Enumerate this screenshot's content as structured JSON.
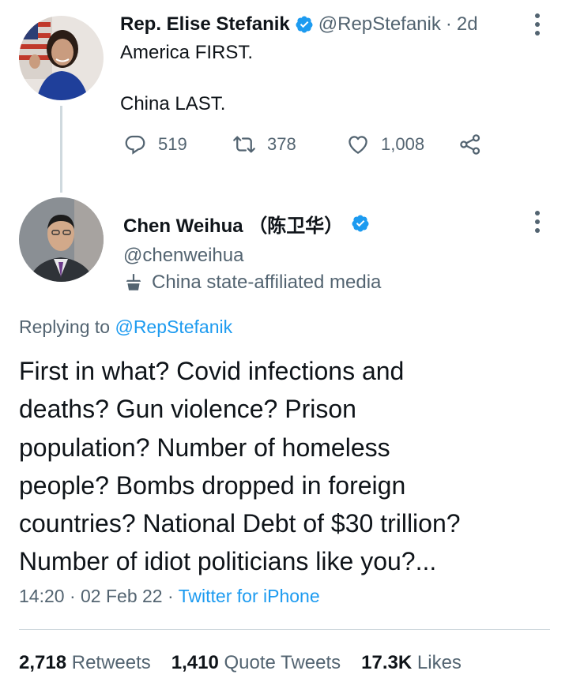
{
  "parent_tweet": {
    "author_name": "Rep. Elise Stefanik",
    "handle": "@RepStefanik",
    "separator": "·",
    "time_ago": "2d",
    "line1": "America FIRST.",
    "line2": "China LAST.",
    "replies": "519",
    "retweets": "378",
    "likes": "1,008"
  },
  "focused_tweet": {
    "author_name": "Chen Weihua （陈卫华）",
    "handle": "@chenweihua",
    "affiliation": "China state-affiliated media",
    "replying_prefix": "Replying to",
    "replying_handle": "@RepStefanik",
    "text_lines": [
      "First in what? Covid infections and",
      "deaths? Gun violence? Prison",
      "population? Number of homeless",
      "people? Bombs dropped in foreign",
      "countries? National Debt of $30 trillion?",
      "Number of idiot politicians like you?..."
    ],
    "time": "14:20",
    "date": "02 Feb 22",
    "dot": "·",
    "source": "Twitter for iPhone",
    "stats": {
      "retweets_count": "2,718",
      "retweets_label": "Retweets",
      "quotes_count": "1,410",
      "quotes_label": "Quote Tweets",
      "likes_count": "17.3K",
      "likes_label": "Likes"
    }
  },
  "colors": {
    "text": "#0f1419",
    "secondary": "#536471",
    "link": "#1d9bf0",
    "verified": "#1d9bf0",
    "line": "#cfd9de"
  }
}
